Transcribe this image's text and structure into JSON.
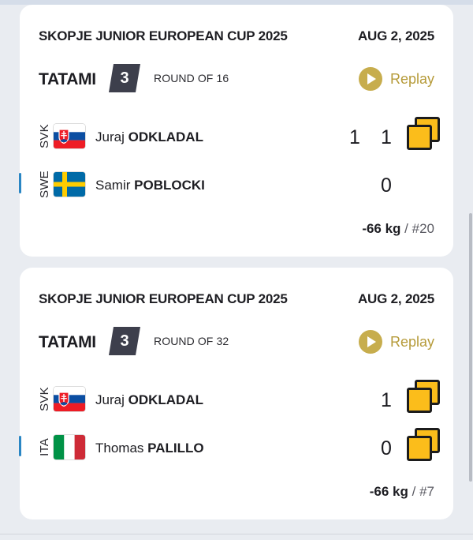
{
  "matches": [
    {
      "event": "SKOPJE JUNIOR EUROPEAN CUP 2025",
      "date": "AUG 2, 2025",
      "tatami_label": "TATAMI",
      "tatami_number": "3",
      "round": "ROUND OF 16",
      "replay_label": "Replay",
      "athletes": [
        {
          "country": "SVK",
          "first_name": "Juraj",
          "last_name": "ODKLADAL",
          "score_a": "1",
          "score_b": "1",
          "penalty": true
        },
        {
          "country": "SWE",
          "first_name": "Samir",
          "last_name": "POBLOCKI",
          "score_a": "",
          "score_b": "0",
          "penalty": false
        }
      ],
      "weight": "-66 kg",
      "weight_suffix": " / #20"
    },
    {
      "event": "SKOPJE JUNIOR EUROPEAN CUP 2025",
      "date": "AUG 2, 2025",
      "tatami_label": "TATAMI",
      "tatami_number": "3",
      "round": "ROUND OF 32",
      "replay_label": "Replay",
      "athletes": [
        {
          "country": "SVK",
          "first_name": "Juraj",
          "last_name": "ODKLADAL",
          "score_a": "",
          "score_b": "1",
          "penalty": true
        },
        {
          "country": "ITA",
          "first_name": "Thomas",
          "last_name": "PALILLO",
          "score_a": "",
          "score_b": "0",
          "penalty": true
        }
      ],
      "weight": "-66 kg",
      "weight_suffix": " / #7"
    }
  ],
  "colors": {
    "accent_gold": "#c7ad4d",
    "penalty_yellow": "#fbbd1b",
    "tatami_badge": "#3d3f4c",
    "side_indicator_blue": "#2a86c4"
  },
  "icons": {
    "replay": "play-circle-icon",
    "penalty": "shido-card-icon"
  }
}
